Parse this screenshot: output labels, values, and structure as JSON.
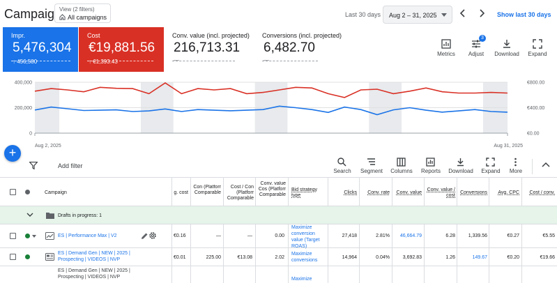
{
  "header": {
    "title": "Campaigns",
    "view_filters": "View (2 filters)",
    "view_name": "All campaigns",
    "range_label": "Last 30 days",
    "date_range": "Aug 2 – 31, 2025",
    "show_last": "Show last 30 days"
  },
  "metrics": [
    {
      "label": "Impr.",
      "value": "5,476,304",
      "delta": "↑ 456,580",
      "color": "#1a73e8"
    },
    {
      "label": "Cost",
      "value": "€19,881.56",
      "delta": "↑ €1,393.43",
      "color": "#d93025"
    },
    {
      "label": "Conv. value (incl. projected)",
      "value": "216,713.31",
      "delta": "—"
    },
    {
      "label": "Conversions (incl. projected)",
      "value": "6,482.70",
      "delta": "—"
    }
  ],
  "metric_tools": [
    "Metrics",
    "Adjust",
    "Download",
    "Expand"
  ],
  "adjust_badge": "3",
  "chart_data": {
    "type": "line",
    "x": [
      "Aug 2",
      "Aug 3",
      "Aug 4",
      "Aug 5",
      "Aug 6",
      "Aug 7",
      "Aug 8",
      "Aug 9",
      "Aug 10",
      "Aug 11",
      "Aug 12",
      "Aug 13",
      "Aug 14",
      "Aug 15",
      "Aug 16",
      "Aug 17",
      "Aug 18",
      "Aug 19",
      "Aug 20",
      "Aug 21",
      "Aug 22",
      "Aug 23",
      "Aug 24",
      "Aug 25",
      "Aug 26",
      "Aug 27",
      "Aug 28",
      "Aug 29",
      "Aug 30",
      "Aug 31"
    ],
    "x_tick_labels": [
      "Aug 2, 2025",
      "Aug 31, 2025"
    ],
    "left_axis_ticks": [
      "400,000",
      "200,000",
      "0"
    ],
    "right_axis_ticks": [
      "€800.00",
      "€400.00",
      "€0.00"
    ],
    "ylim_left": [
      0,
      400000
    ],
    "ylim_right": [
      0,
      800
    ],
    "series": [
      {
        "name": "Impr.",
        "axis": "left",
        "color": "#1a73e8",
        "values": [
          182000,
          205000,
          192000,
          178000,
          180000,
          183000,
          170000,
          175000,
          190000,
          170000,
          185000,
          180000,
          176000,
          180000,
          185000,
          212000,
          200000,
          185000,
          163000,
          205000,
          185000,
          145000,
          183000,
          200000,
          180000,
          165000,
          175000,
          185000,
          170000,
          165000
        ]
      },
      {
        "name": "Cost",
        "axis": "right",
        "color": "#d93025",
        "values": [
          660,
          700,
          680,
          650,
          720,
          705,
          700,
          620,
          790,
          620,
          700,
          680,
          700,
          620,
          640,
          680,
          720,
          710,
          620,
          560,
          680,
          690,
          620,
          660,
          710,
          650,
          630,
          630,
          640,
          630
        ]
      }
    ],
    "weekend_bands": true,
    "grid": true
  },
  "table_toolbar": {
    "add_filter": "Add filter",
    "tools": [
      "Search",
      "Segment",
      "Columns",
      "Reports",
      "Download",
      "Expand",
      "More"
    ]
  },
  "columns": {
    "campaign": "Campaign",
    "avg_cost": "g. cost",
    "comp1": "Con (Platforr Comparable",
    "comp2": "Cost / Con (Platforr Comparable",
    "comp3": "Conv. value Cos (Platforr Comparable",
    "bid": "Bid strategy type",
    "clicks": "Clicks",
    "conv_rate": "Conv. rate",
    "conv_value": "Conv. value",
    "value_cost": "Conv. value / cost",
    "conversions": "Conversions",
    "avg_cpc": "Avg. CPC",
    "cost_conv": "Cost / conv."
  },
  "drafts": "Drafts in progress: 1",
  "rows": [
    {
      "name": "ES | Performance Max | V2",
      "avg_cost": "€0.16",
      "c1": "—",
      "c2": "—",
      "c3": "0.00",
      "bid": "Maximize conversion value (Target ROAS)",
      "clicks": "27,418",
      "conv_rate": "2.81%",
      "conv_value": "46,664.79",
      "value_cost": "6.28",
      "conversions": "1,339.56",
      "avg_cpc": "€0.27",
      "cost_conv": "€5.55"
    },
    {
      "name": "ES | Demand Gen | NEW | 2025 | Prospecting | VIDEOS | NVP",
      "avg_cost": "€0.01",
      "c1": "225.00",
      "c2": "€13.08",
      "c3": "2.02",
      "bid": "Maximize conversions",
      "clicks": "14,964",
      "conv_rate": "0.04%",
      "conv_value": "3,692.83",
      "value_cost": "1.26",
      "conversions": "149.67",
      "avg_cpc": "€0.20",
      "cost_conv": "€19.66"
    },
    {
      "name": "ES | Demand Gen | NEW | 2025 | Prospecting | VIDEOS | NVP",
      "bid": "Maximize"
    }
  ]
}
